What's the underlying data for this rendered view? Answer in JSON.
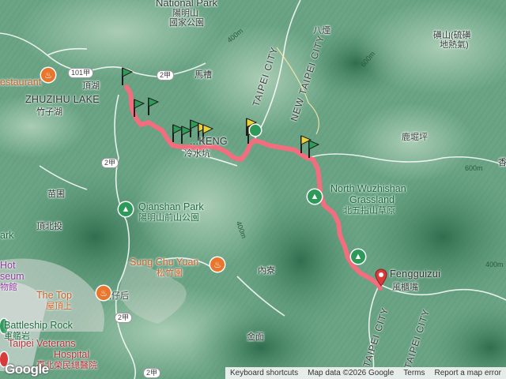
{
  "map": {
    "places": {
      "national_park_en": "National Park",
      "national_park_zh_1": "陽明山",
      "national_park_zh_2": "國家公園",
      "bayan": "八煙",
      "lishan": "磺山(硫磺",
      "lishan2": "地熱氣)",
      "machao": "馬槽",
      "dinghu": "頂湖",
      "zhuzihu_en": "ZHUZIHU LAKE",
      "zhuzihu_zh": "竹子湖",
      "lengshui_en": "...KENG",
      "lengshui_zh": "冷水坑",
      "luqueping": "鹿堀坪",
      "miaopu": "苗圃",
      "dingbeitou": "頂北投",
      "shanzihou": "山仔后",
      "neiliao": "內寮",
      "jinmian": "金面",
      "xiang": "香"
    },
    "pois": {
      "restaurant": "estaurant",
      "qianshan_en": "Qianshan Park",
      "qianshan_zh": "陽明山前山公園",
      "sungchuyuan_en": "Sung Chu Yuan",
      "sungchuyuan_zh": "松竹園",
      "thetop_en": "The Top",
      "thetop_zh": "屋頂上",
      "hot_en": "Hot",
      "museum_en": "seum",
      "museum_zh": "物館",
      "battleship_en": "Battleship Rock",
      "battleship_zh": "軍艦岩",
      "grassland_en_1": "North Wuzhishan",
      "grassland_en_2": "Grassland",
      "grassland_zh": "北五指山草原",
      "fengguizui_en": "Fengguizui",
      "fengguizui_zh": "風櫃嘴",
      "veterans_en_1": "Taipei Veterans",
      "veterans_en_2": "Hospital",
      "veterans_zh": "臺北榮民總醫院",
      "park_left": "ark"
    },
    "districts": {
      "taipei_city_1": "TAIPEI CITY",
      "new_taipei_city": "NEW TAIPEI CITY",
      "taipei_city_2": "TAIPEI CITY",
      "taipei_city_3": "TAIPEI CITY"
    },
    "roads": {
      "r101": "101甲",
      "r2a_1": "2甲",
      "r2a_2": "2甲",
      "r2a_3": "2甲",
      "r2a_4": "2甲"
    },
    "contours": {
      "c400": "400m",
      "c600": "600m",
      "c300": "300m"
    }
  },
  "track": {
    "color": "#f26d7d",
    "start_color": "#2e9b56",
    "waypoint_color": "#e8d33a",
    "end_color": "#d93b3b"
  },
  "attribution": {
    "logo": "Google",
    "keyboard": "Keyboard shortcuts",
    "data": "Map data ©2026 Google",
    "terms": "Terms",
    "report": "Report a map error"
  }
}
